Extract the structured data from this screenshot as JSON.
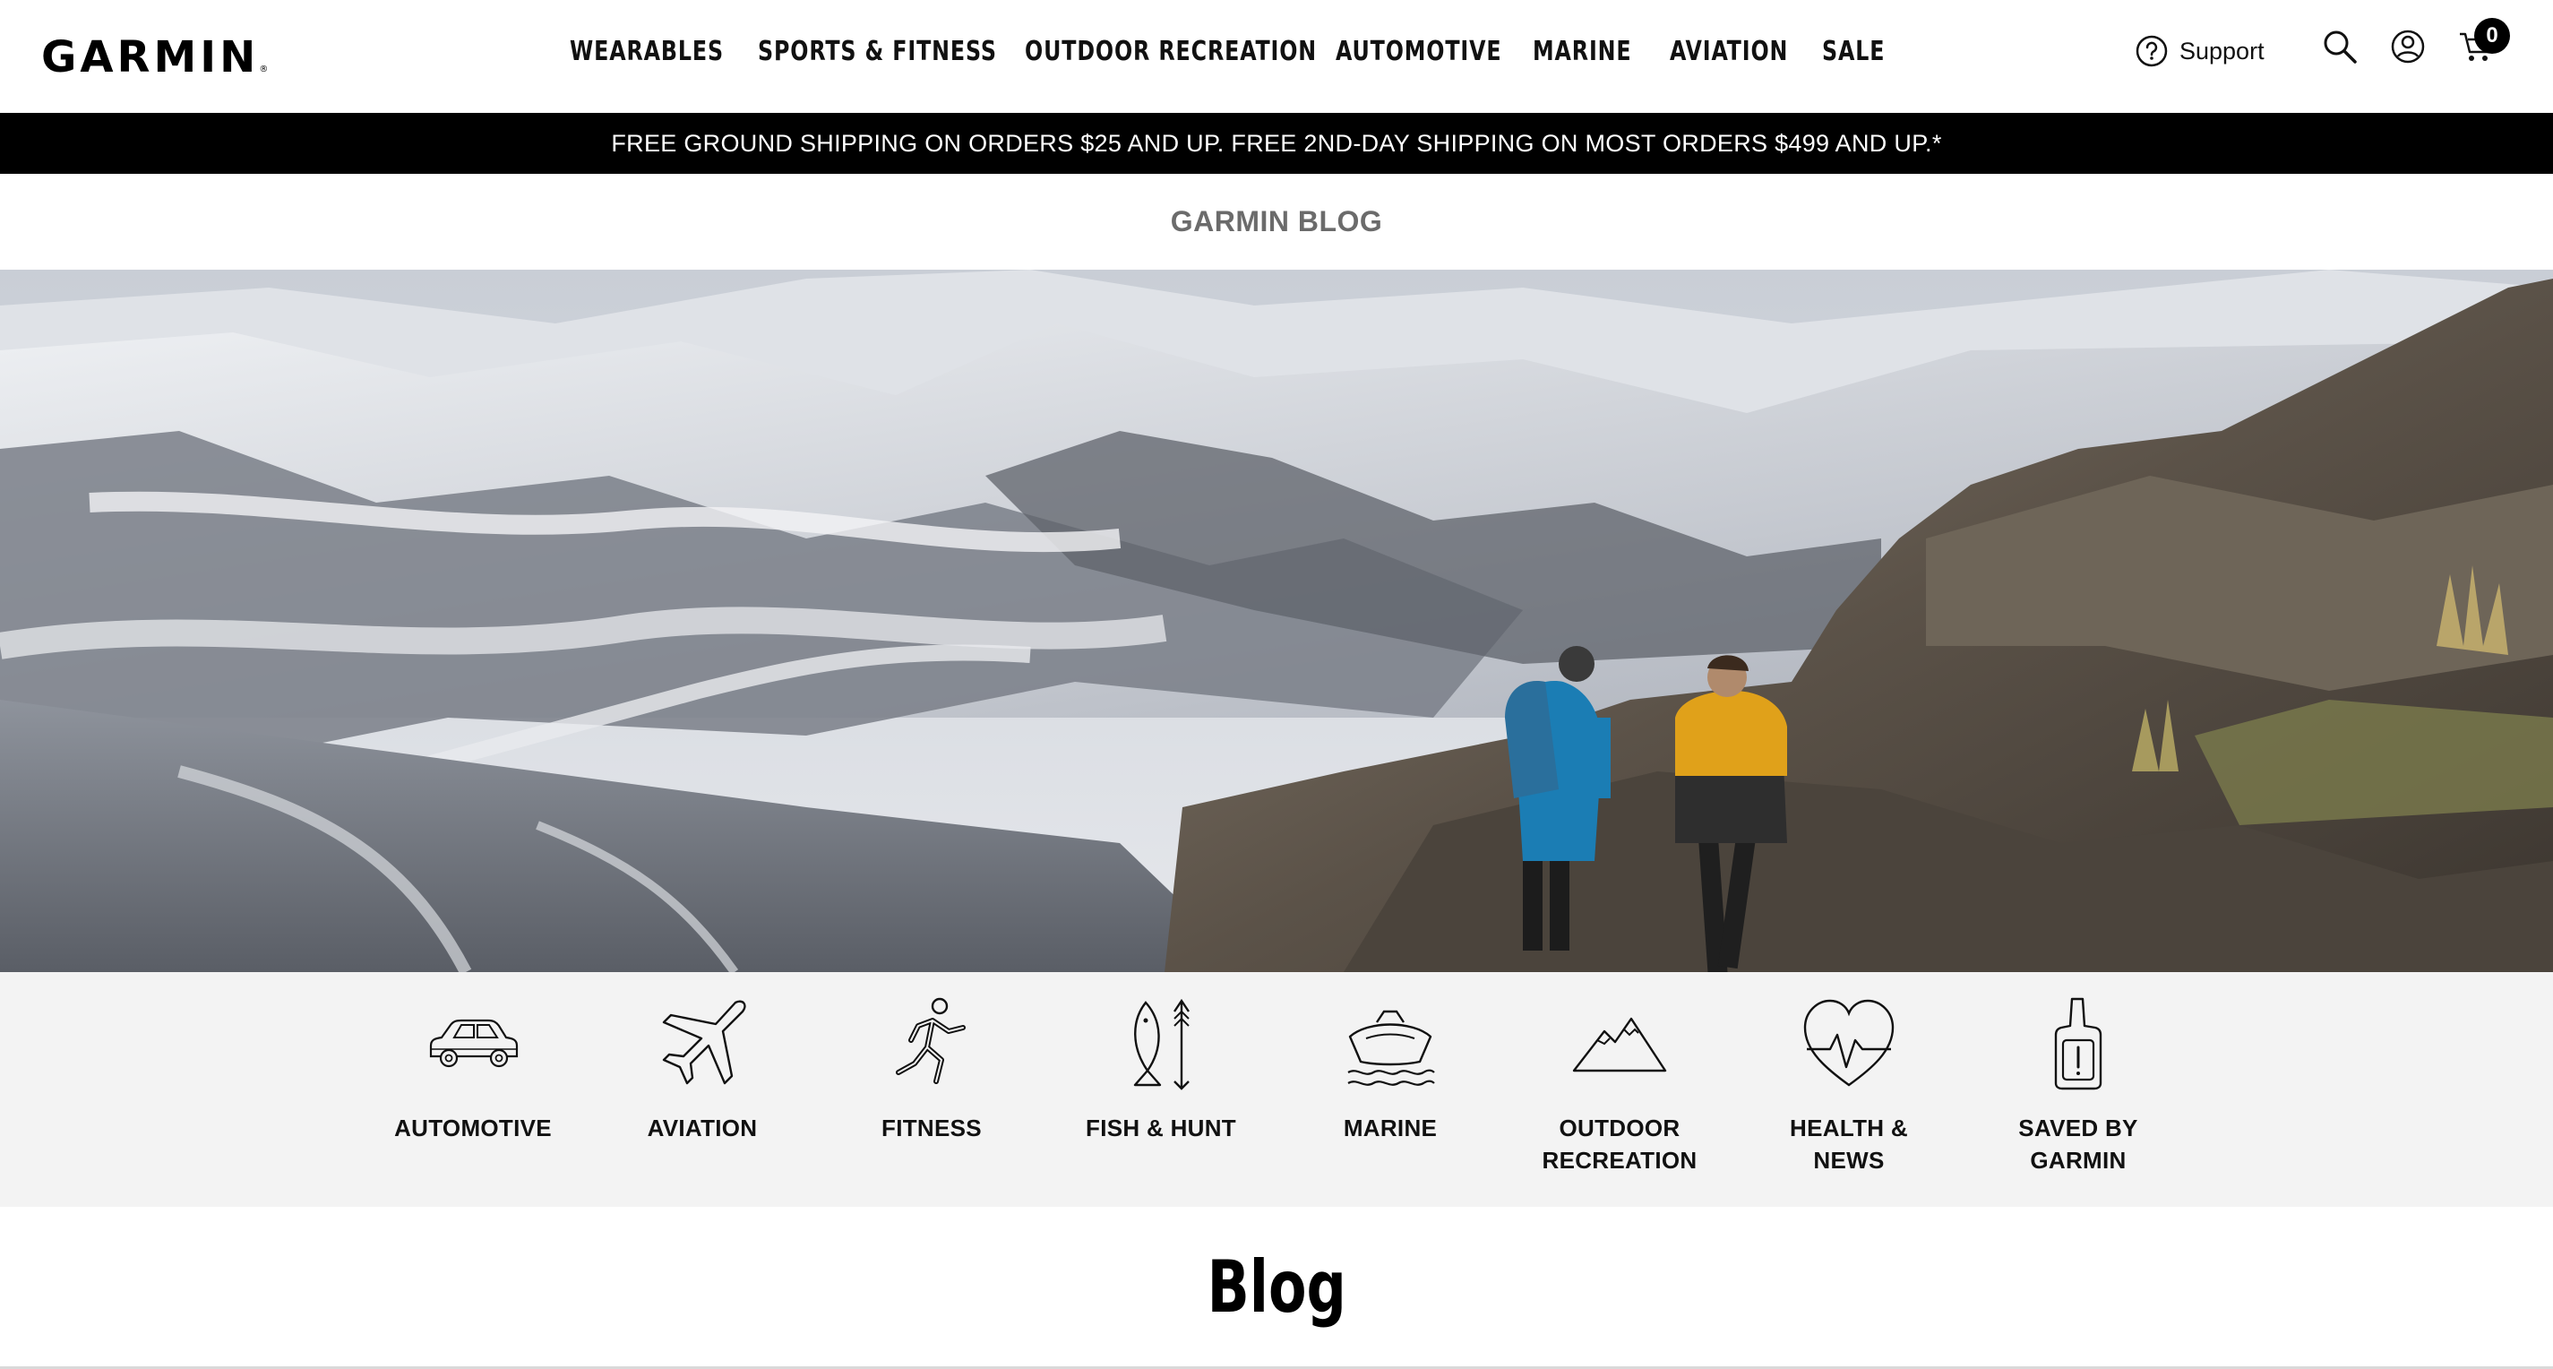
{
  "header": {
    "logo": "GARMIN",
    "logo_mark": "®",
    "nav": [
      "WEARABLES",
      "SPORTS & FITNESS",
      "OUTDOOR RECREATION",
      "AUTOMOTIVE",
      "MARINE",
      "AVIATION",
      "SALE"
    ],
    "support_label": "Support",
    "cart_count": "0",
    "icons": {
      "support": "question-circle-icon",
      "search": "search-icon",
      "account": "account-icon",
      "cart": "cart-icon"
    }
  },
  "promo": {
    "text": "FREE GROUND SHIPPING ON ORDERS $25 AND UP. FREE 2ND-DAY SHIPPING ON MOST ORDERS $499 AND UP.*"
  },
  "blog_label": "GARMIN BLOG",
  "categories": [
    {
      "label": "AUTOMOTIVE",
      "icon": "car-icon"
    },
    {
      "label": "AVIATION",
      "icon": "airplane-icon"
    },
    {
      "label": "FITNESS",
      "icon": "runner-icon"
    },
    {
      "label": "FISH & HUNT",
      "icon": "fish-arrow-icon"
    },
    {
      "label": "MARINE",
      "icon": "boat-icon"
    },
    {
      "label": "OUTDOOR\nRECREATION",
      "icon": "mountain-icon"
    },
    {
      "label": "HEALTH &\nNEWS",
      "icon": "heart-pulse-icon"
    },
    {
      "label": "SAVED BY\nGARMIN",
      "icon": "inreach-device-icon"
    }
  ],
  "page_heading": "Blog",
  "colors": {
    "promo_bg": "#000000",
    "category_bg": "#f3f3f3",
    "blog_label": "#6b6b6b"
  }
}
